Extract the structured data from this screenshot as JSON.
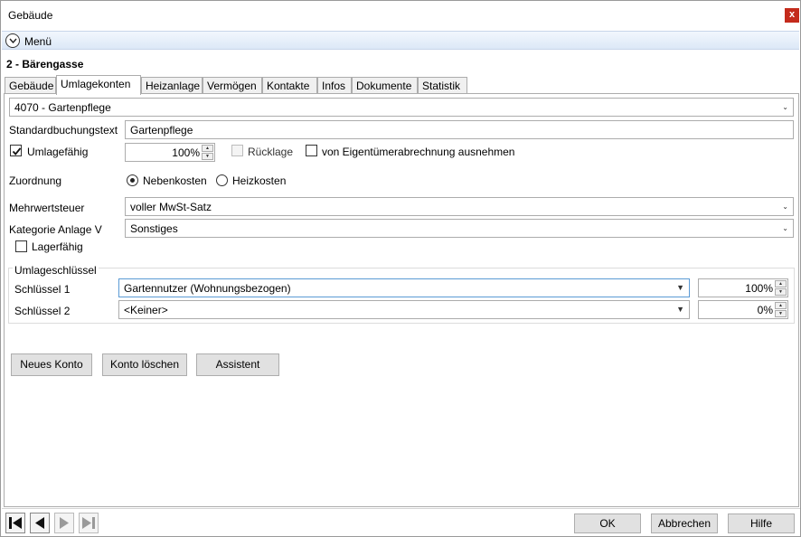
{
  "window": {
    "title": "Gebäude",
    "close_label": "x"
  },
  "menu": {
    "label": "Menü"
  },
  "header": {
    "title": "2 - Bärengasse"
  },
  "tabs": [
    {
      "label": "Gebäude"
    },
    {
      "label": "Umlagekonten"
    },
    {
      "label": "Heizanlage"
    },
    {
      "label": "Vermögen"
    },
    {
      "label": "Kontakte"
    },
    {
      "label": "Infos"
    },
    {
      "label": "Dokumente"
    },
    {
      "label": "Statistik"
    }
  ],
  "active_tab": "Umlagekonten",
  "account": {
    "selected": "4070 - Gartenpflege"
  },
  "form": {
    "standard_text_label": "Standardbuchungstext",
    "standard_text_value": "Gartenpflege",
    "umlagefaehig_label": "Umlagefähig",
    "umlagefaehig_checked": true,
    "umlagefaehig_percent": "100%",
    "ruecklage_label": "Rücklage",
    "ruecklage_checked": false,
    "exclude_label": "von Eigentümerabrechnung ausnehmen",
    "exclude_checked": false,
    "zuordnung_label": "Zuordnung",
    "radio_nebenkosten": "Nebenkosten",
    "radio_heizkosten": "Heizkosten",
    "zuordnung_selected": "Nebenkosten",
    "mwst_label": "Mehrwertsteuer",
    "mwst_value": "voller MwSt-Satz",
    "kategorie_label": "Kategorie Anlage V",
    "kategorie_value": "Sonstiges",
    "lagerfaehig_label": "Lagerfähig",
    "lagerfaehig_checked": false
  },
  "umlageschluessel": {
    "group_label": "Umlageschlüssel",
    "rows": [
      {
        "label": "Schlüssel 1",
        "value": "Gartennutzer (Wohnungsbezogen)",
        "percent": "100%"
      },
      {
        "label": "Schlüssel 2",
        "value": "<Keiner>",
        "percent": "0%"
      }
    ]
  },
  "actions": {
    "new": "Neues Konto",
    "delete": "Konto löschen",
    "assistant": "Assistent"
  },
  "footer": {
    "ok": "OK",
    "cancel": "Abbrechen",
    "help": "Hilfe"
  },
  "icons": [
    "chevron-down-icon",
    "check-icon",
    "first-record-icon",
    "previous-record-icon",
    "next-record-icon",
    "last-record-icon"
  ],
  "colors": {
    "close_button": "#c42b1c",
    "menu_bar": "#dce8f7",
    "focus_border": "#5b9bd5"
  }
}
